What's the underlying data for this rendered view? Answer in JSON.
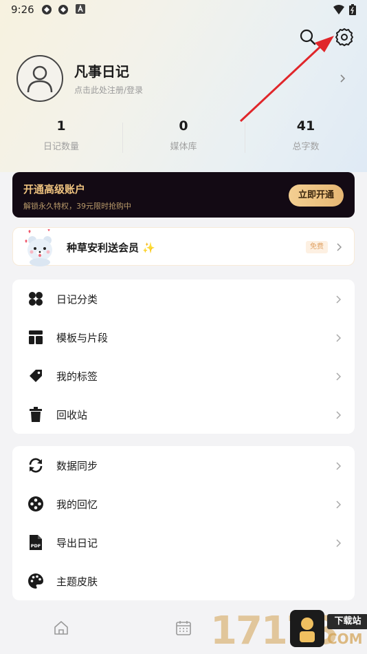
{
  "status_bar": {
    "time": "9:26"
  },
  "profile": {
    "name": "凡事日记",
    "subtitle": "点击此处注册/登录"
  },
  "stats": [
    {
      "value": "1",
      "label": "日记数量"
    },
    {
      "value": "0",
      "label": "媒体库"
    },
    {
      "value": "41",
      "label": "总字数"
    }
  ],
  "vip": {
    "title": "开通高级账户",
    "subtitle": "解锁永久特权，39元限时抢购中",
    "button": "立即开通"
  },
  "promo": {
    "text": "种草安利送会员 ✨",
    "badge": "免费"
  },
  "menu_group_1": [
    {
      "label": "日记分类",
      "icon": "category-icon"
    },
    {
      "label": "模板与片段",
      "icon": "template-icon"
    },
    {
      "label": "我的标签",
      "icon": "tag-icon"
    },
    {
      "label": "回收站",
      "icon": "trash-icon"
    }
  ],
  "menu_group_2": [
    {
      "label": "数据同步",
      "icon": "sync-icon"
    },
    {
      "label": "我的回忆",
      "icon": "memory-icon"
    },
    {
      "label": "导出日记",
      "icon": "pdf-icon"
    },
    {
      "label": "主题皮肤",
      "icon": "palette-icon"
    }
  ],
  "watermark": {
    "digits": "17173",
    "badge": "下载站",
    "domain": "COM"
  },
  "colors": {
    "vip_bg": "#130a14",
    "vip_gold": "#eec27f",
    "arrow": "#e0262a"
  }
}
